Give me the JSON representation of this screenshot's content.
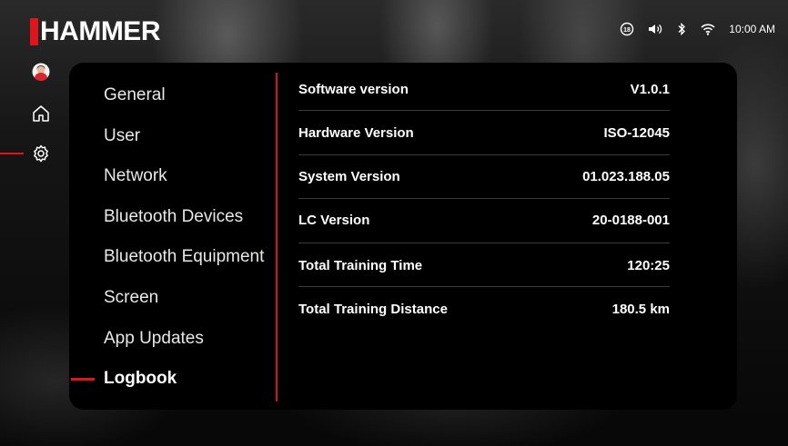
{
  "brand": {
    "name": "HAMMER",
    "accent": "#e0141e"
  },
  "status_bar": {
    "time": "10:00 AM",
    "icons": [
      "age-18-icon",
      "volume-icon",
      "bluetooth-icon",
      "wifi-icon"
    ]
  },
  "sidebar": {
    "icons": [
      "profile-avatar-icon",
      "home-icon",
      "settings-gear-icon"
    ],
    "active": "settings-gear-icon"
  },
  "settings_menu": {
    "items": [
      {
        "label": "General"
      },
      {
        "label": "User"
      },
      {
        "label": "Network"
      },
      {
        "label": "Bluetooth Devices"
      },
      {
        "label": "Bluetooth Equipment"
      },
      {
        "label": "Screen"
      },
      {
        "label": "App Updates"
      },
      {
        "label": "Logbook"
      }
    ],
    "active": "Logbook"
  },
  "info": {
    "rows": [
      {
        "label": "Software version",
        "value": "V1.0.1"
      },
      {
        "label": "Hardware Version",
        "value": "ISO-12045"
      },
      {
        "label": "System Version",
        "value": "01.023.188.05"
      },
      {
        "label": "LC Version",
        "value": "20-0188-001"
      },
      {
        "label": "Total Training Time",
        "value": "120:25"
      },
      {
        "label": "Total Training Distance",
        "value": "180.5 km"
      }
    ]
  }
}
